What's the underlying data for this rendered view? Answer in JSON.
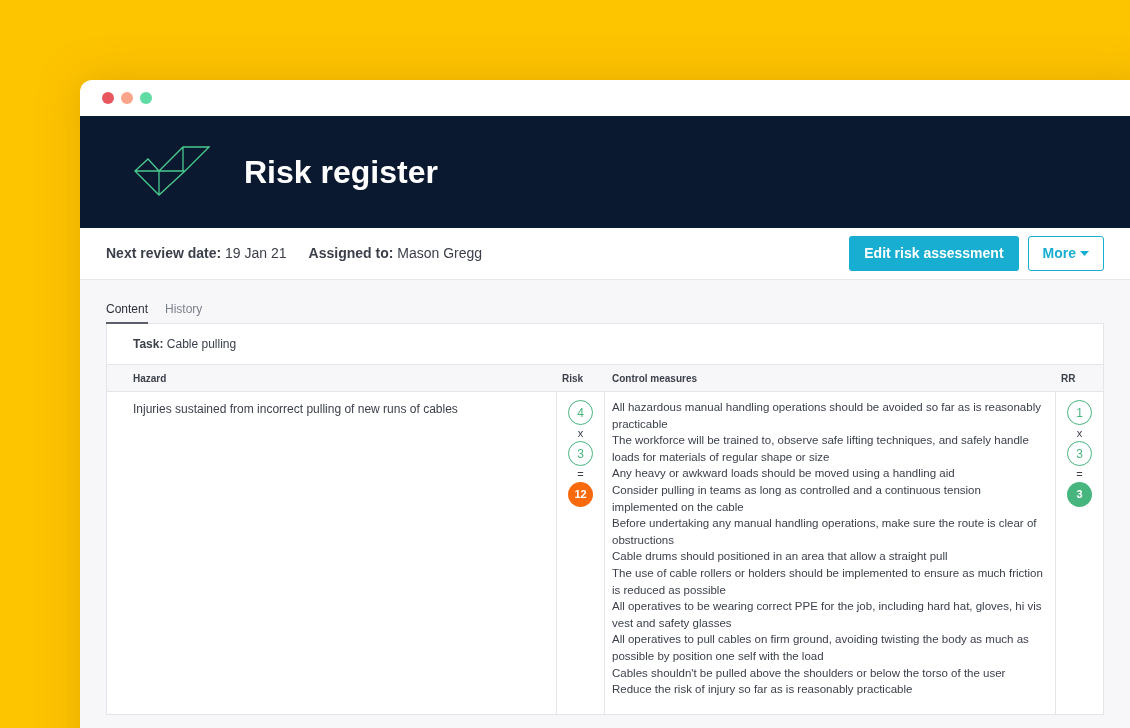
{
  "window": {
    "title": "Risk register"
  },
  "meta": [
    {
      "label": "Next review date:",
      "value": "19 Jan 21"
    },
    {
      "label": "Assigned to:",
      "value": "Mason Gregg"
    }
  ],
  "actions": [
    {
      "label": "Edit risk assessment",
      "kind": "primary"
    },
    {
      "label": "More",
      "kind": "dropdown"
    }
  ],
  "tabs": [
    {
      "label": "Content",
      "selected": true
    },
    {
      "label": "History",
      "selected": false
    }
  ],
  "task": {
    "label": "Task:",
    "value": "Cable pulling"
  },
  "table": {
    "columns": [
      "Hazard",
      "Risk",
      "Control measures",
      "RR"
    ],
    "rows": [
      {
        "hazard": "Injuries sustained from incorrect pulling of new runs of cables",
        "risk": {
          "factors": [
            "4",
            "3"
          ],
          "times": "x",
          "equals": "=",
          "score": "12",
          "color": "#f86a0c"
        },
        "control_measures": [
          "All hazardous manual handling operations should be avoided so far as is reasonably practicable",
          "The workforce will be trained to, observe safe lifting techniques, and safely handle loads for materials of regular shape or size",
          "Any heavy or awkward loads should be moved using a handling aid",
          "Consider pulling in teams as long as controlled and a continuous tension implemented on the cable",
          "Before undertaking any manual handling operations, make sure the route is clear of obstructions",
          "Cable drums should positioned in an area that allow a straight pull",
          "The use of cable rollers or holders should be implemented to ensure as much friction is reduced as possible",
          "All operatives to be wearing correct PPE for the job, including hard hat, gloves, hi vis vest and safety glasses",
          "All operatives to pull cables on firm ground, avoiding twisting the body as much as possible by position one self with the load",
          "Cables shouldn't be pulled above the shoulders or below the torso of the user",
          "Reduce the risk of injury so far as is reasonably practicable"
        ],
        "residual": {
          "factors": [
            "1",
            "3"
          ],
          "times": "x",
          "equals": "=",
          "score": "3",
          "color": "#47b57e"
        }
      }
    ]
  }
}
